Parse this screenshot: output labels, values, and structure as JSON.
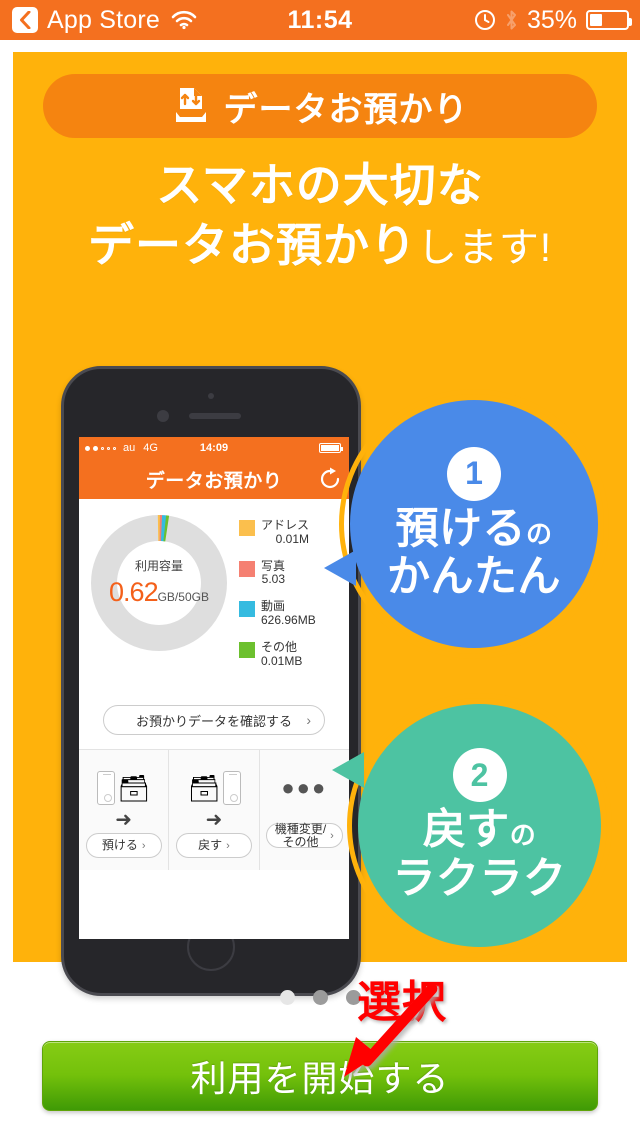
{
  "statusbar": {
    "back_label": "App Store",
    "back_icon": "chevron-left-icon",
    "wifi_icon": "wifi-icon",
    "time": "11:54",
    "alarm_icon": "alarm-clock-icon",
    "bluetooth_icon": "bluetooth-icon",
    "battery_percent": "35%",
    "battery_icon": "battery-icon",
    "background": "#f4701f"
  },
  "card": {
    "background": "#ffb20b",
    "pill": {
      "icon": "data-backup-icon",
      "title": "データお預かり",
      "background": "#f58410"
    },
    "headline_line1": "スマホの大切な",
    "headline_line2": "データお預かり",
    "headline_line2_suffix": "します!"
  },
  "phone_mockup": {
    "inner_statusbar": {
      "carrier": "au",
      "network": "4G",
      "time": "14:09"
    },
    "inner_header": {
      "title": "データお預かり",
      "refresh_icon": "refresh-icon"
    },
    "donut": {
      "center_label": "利用容量",
      "value": "0.62",
      "unit": "GB/50GB",
      "value_color": "#f4601a",
      "track_color": "#dddddd"
    },
    "legend": [
      {
        "color": "#fbbf4d",
        "name": "アドレス",
        "value": "0.01M"
      },
      {
        "color": "#f58072",
        "name": "写真",
        "value": "5.03"
      },
      {
        "color": "#35bbe0",
        "name": "動画",
        "value": "626.96MB"
      },
      {
        "color": "#6cc02e",
        "name": "その他",
        "value": "0.01MB"
      }
    ],
    "confirm_button": {
      "label": "お預かりデータを確認する",
      "chevron": "›"
    },
    "tiles": [
      {
        "label": "預ける",
        "chevron": "›",
        "art": "phone-to-box-icon"
      },
      {
        "label": "戻す",
        "chevron": "›",
        "art": "box-to-phone-icon"
      },
      {
        "label_line1": "機種変更/",
        "label_line2": "その他",
        "chevron": "›",
        "art": "more-dots-icon"
      }
    ]
  },
  "bubbles": [
    {
      "number": "1",
      "line1": "預ける",
      "line1_small": "の",
      "line2": "かんたん",
      "color": "#4a8ae8"
    },
    {
      "number": "2",
      "line1": "戻す",
      "line1_small": "の",
      "line2": "ラクラク",
      "color": "#4dc3a2"
    }
  ],
  "footer": {
    "page_dots": [
      "light",
      "dark",
      "dark"
    ],
    "cta_label": "利用を開始する",
    "cta_color": "#74c10b"
  },
  "annotation": {
    "label": "選択",
    "color": "#ff0000",
    "arrow_icon": "arrow-down-left-icon"
  }
}
